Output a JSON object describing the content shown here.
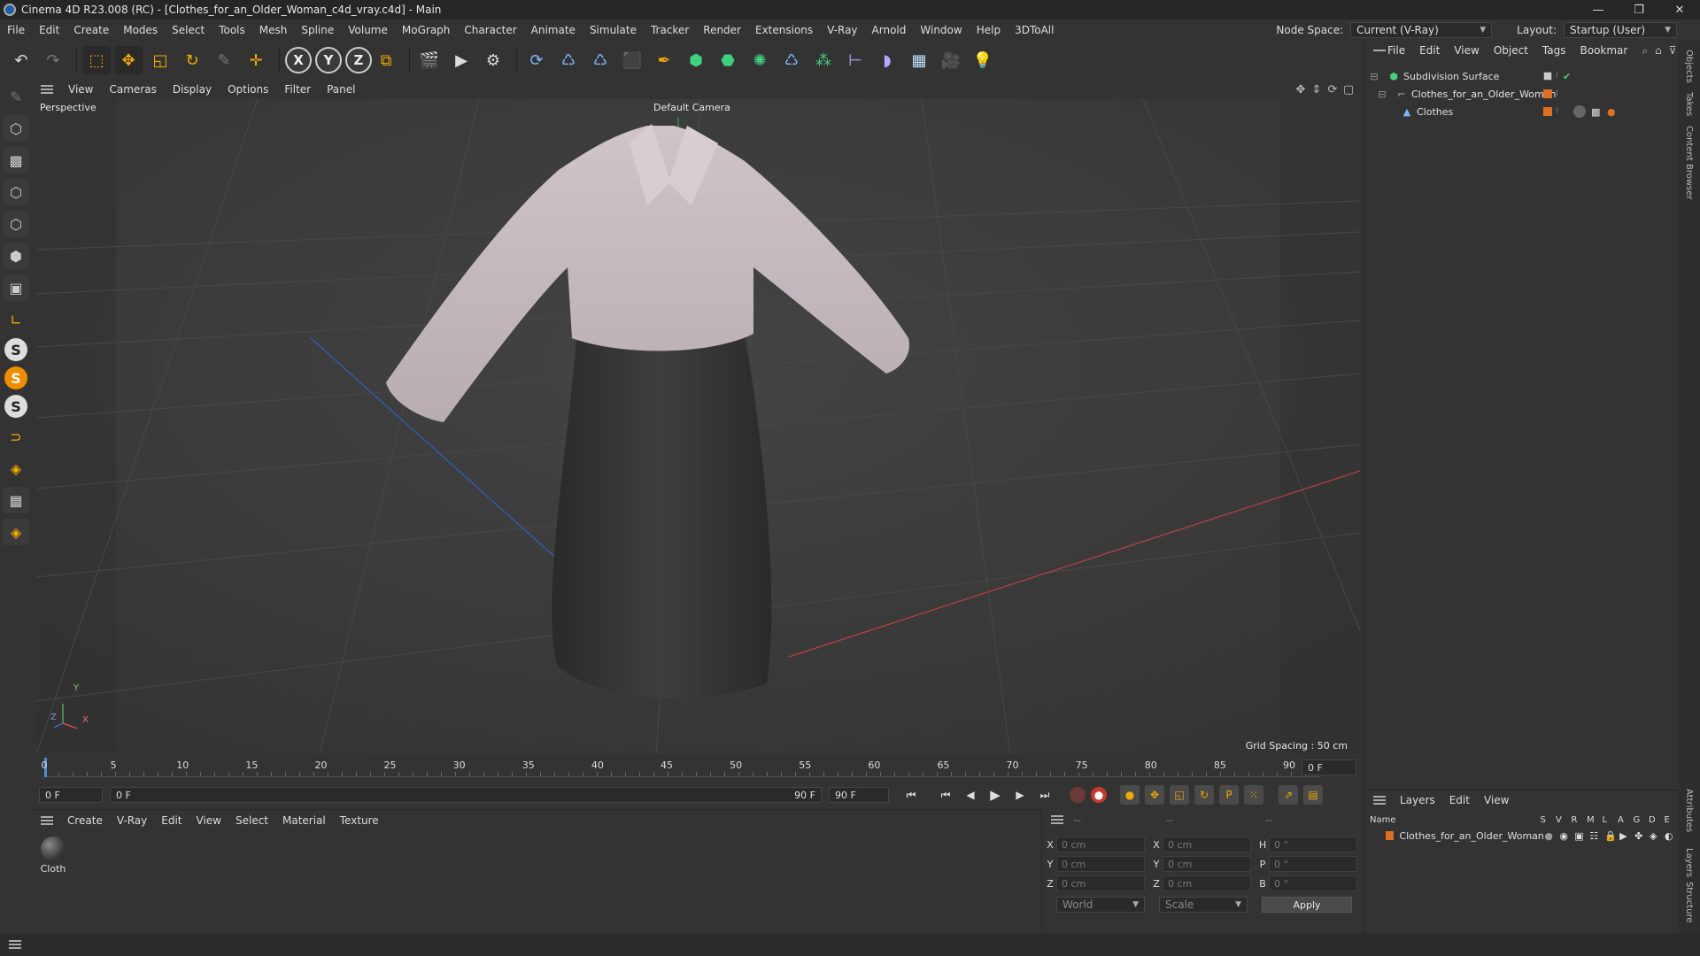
{
  "window": {
    "title": "Cinema 4D R23.008 (RC) - [Clothes_for_an_Older_Woman_c4d_vray.c4d] - Main",
    "controls": [
      "—",
      "❐",
      "✕"
    ]
  },
  "menu": [
    "File",
    "Edit",
    "Create",
    "Modes",
    "Select",
    "Tools",
    "Mesh",
    "Spline",
    "Volume",
    "MoGraph",
    "Character",
    "Animate",
    "Simulate",
    "Tracker",
    "Render",
    "Extensions",
    "V-Ray",
    "Arnold",
    "Window",
    "Help",
    "3DToAll"
  ],
  "node_space": {
    "label": "Node Space:",
    "value": "Current (V-Ray)"
  },
  "layout": {
    "label": "Layout:",
    "value": "Startup (User)"
  },
  "toolbar": {
    "axis_x": "X",
    "axis_y": "Y",
    "axis_z": "Z"
  },
  "viewport": {
    "menu": [
      "View",
      "Cameras",
      "Display",
      "Options",
      "Filter",
      "Panel"
    ],
    "view_name": "Perspective",
    "camera": "Default Camera",
    "grid_spacing": "Grid Spacing : 50 cm",
    "axes": {
      "x": "X",
      "y": "Y",
      "z": "Z"
    }
  },
  "timeline": {
    "ticks": [
      "0",
      "5",
      "10",
      "15",
      "20",
      "25",
      "30",
      "35",
      "40",
      "45",
      "50",
      "55",
      "60",
      "65",
      "70",
      "75",
      "80",
      "85",
      "90"
    ],
    "current_frame": "0 F",
    "start_frame": "0 F",
    "range_start": "0 F",
    "range_end": "90 F",
    "end_frame": "90 F"
  },
  "material_panel": {
    "menu": [
      "Create",
      "V-Ray",
      "Edit",
      "View",
      "Select",
      "Material",
      "Texture"
    ],
    "materials": [
      {
        "name": "Cloth"
      }
    ]
  },
  "coord_panel": {
    "header": [
      "--",
      "--",
      "--"
    ],
    "pos": [
      {
        "axis": "X",
        "value": "0 cm"
      },
      {
        "axis": "Y",
        "value": "0 cm"
      },
      {
        "axis": "Z",
        "value": "0 cm"
      }
    ],
    "size": [
      {
        "axis": "X",
        "value": "0 cm"
      },
      {
        "axis": "Y",
        "value": "0 cm"
      },
      {
        "axis": "Z",
        "value": "0 cm"
      }
    ],
    "rot": [
      {
        "axis": "H",
        "value": "0 °"
      },
      {
        "axis": "P",
        "value": "0 °"
      },
      {
        "axis": "B",
        "value": "0 °"
      }
    ],
    "mode1": "World",
    "mode2": "Scale",
    "apply": "Apply"
  },
  "object_panel": {
    "menu": [
      "File",
      "Edit",
      "View",
      "Object",
      "Tags",
      "Bookmar"
    ],
    "objects": [
      {
        "name": "Subdivision Surface"
      },
      {
        "name": "Clothes_for_an_Older_Woman"
      },
      {
        "name": "Clothes"
      }
    ]
  },
  "layer_panel": {
    "menu": [
      "Layers",
      "Edit",
      "View"
    ],
    "columns": {
      "name": "Name",
      "flags": [
        "S",
        "V",
        "R",
        "M",
        "L",
        "A",
        "G",
        "D",
        "E"
      ]
    },
    "layers": [
      {
        "name": "Clothes_for_an_Older_Woman"
      }
    ]
  },
  "side_tabs": [
    "Objects",
    "Takes",
    "Content Browser",
    "Attributes",
    "Layers",
    "Structure"
  ],
  "colors": {
    "accent_orange": "#e07020",
    "record_red": "#c8382c",
    "bg": "#333333"
  }
}
